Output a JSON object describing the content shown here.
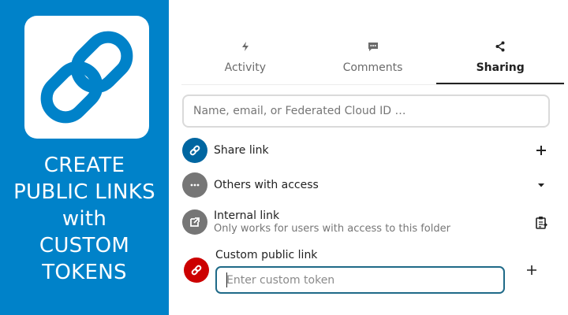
{
  "promo": {
    "lines": [
      "CREATE",
      "PUBLIC LINKS",
      "with",
      "CUSTOM",
      "TOKENS"
    ],
    "logo_icon": "chain-link-icon",
    "background": "#0082c9"
  },
  "tabs": [
    {
      "label": "Activity",
      "icon": "lightning-icon",
      "active": false
    },
    {
      "label": "Comments",
      "icon": "comment-icon",
      "active": false
    },
    {
      "label": "Sharing",
      "icon": "share-icon",
      "active": true
    }
  ],
  "search": {
    "placeholder": "Name, email, or Federated Cloud ID …",
    "value": ""
  },
  "share_link": {
    "label": "Share link",
    "action_icon": "plus-icon",
    "avatar_color": "#0066a1"
  },
  "others": {
    "label": "Others with access",
    "action_icon": "caret-down-icon",
    "avatar_color": "#767676"
  },
  "internal": {
    "label": "Internal link",
    "sublabel": "Only works for users with access to this folder",
    "action_icon": "clipboard-icon",
    "avatar_color": "#767676"
  },
  "custom": {
    "label": "Custom public link",
    "placeholder": "Enter custom token",
    "value": "",
    "action_icon": "plus-icon",
    "avatar_color": "#cc0000"
  }
}
